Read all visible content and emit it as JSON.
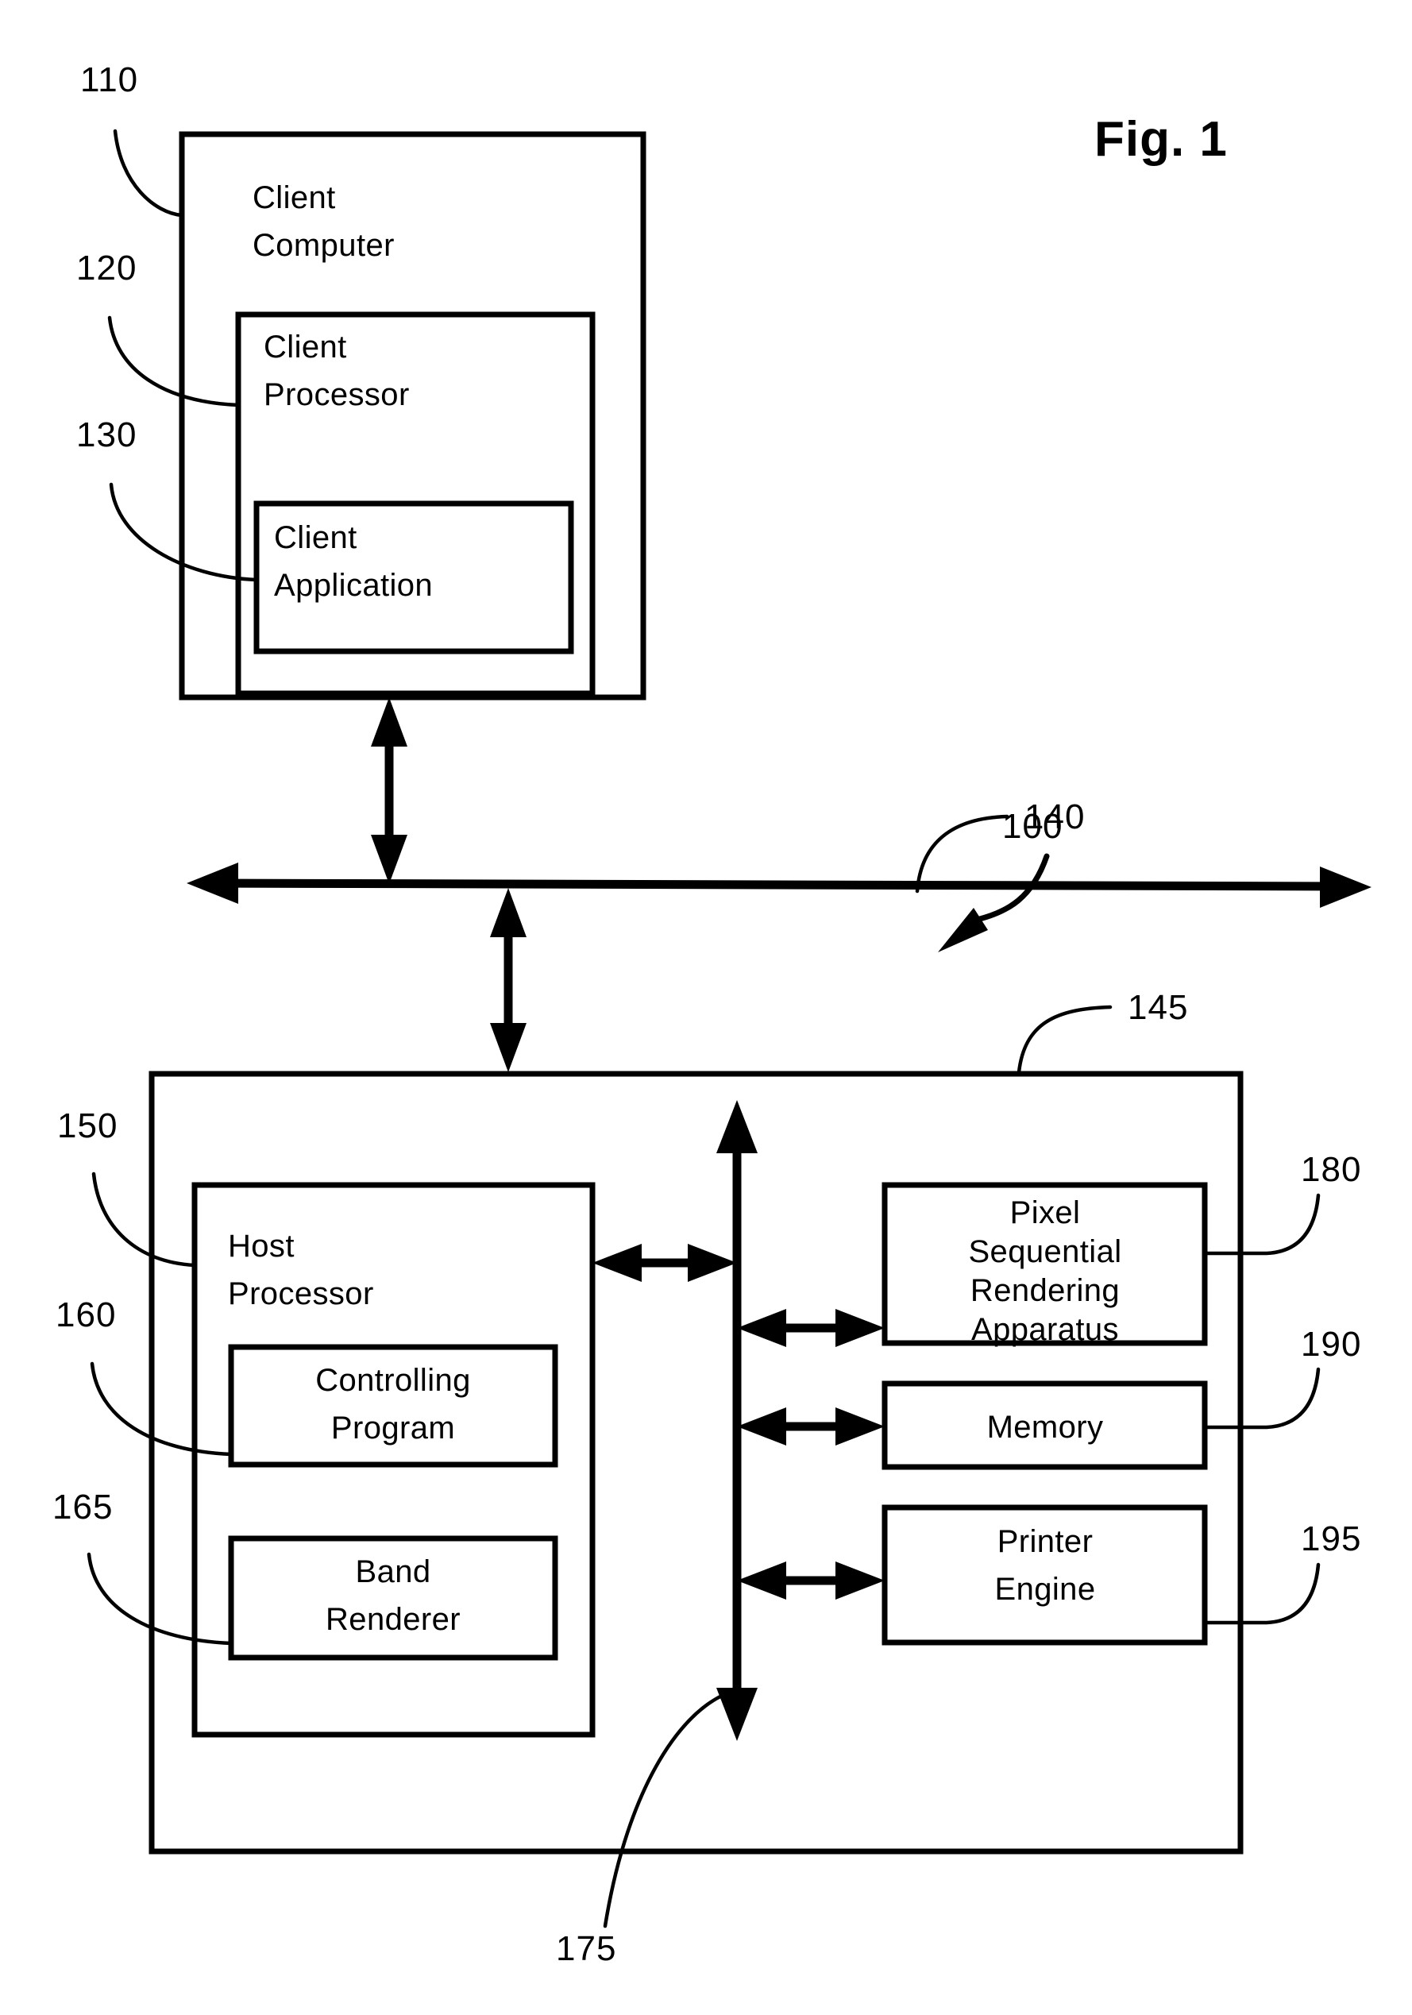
{
  "figure": {
    "title": "Fig. 1",
    "system_reference": "100"
  },
  "blocks": {
    "client_computer": {
      "label_line1": "Client",
      "label_line2": "Computer",
      "ref": "110"
    },
    "client_processor": {
      "label_line1": "Client",
      "label_line2": "Processor",
      "ref": "120"
    },
    "client_application": {
      "label_line1": "Client",
      "label_line2": "Application",
      "ref": "130"
    },
    "network": {
      "ref": "140"
    },
    "host_system": {
      "ref": "145"
    },
    "host_processor": {
      "label_line1": "Host",
      "label_line2": "Processor",
      "ref": "150"
    },
    "controlling_program": {
      "label_line1": "Controlling",
      "label_line2": "Program",
      "ref": "160"
    },
    "band_renderer": {
      "label_line1": "Band",
      "label_line2": "Renderer",
      "ref": "165"
    },
    "system_bus": {
      "ref": "175"
    },
    "pixel_sequential_rendering_apparatus": {
      "label_line1": "Pixel",
      "label_line2": "Sequential",
      "label_line3": "Rendering",
      "label_line4": "Apparatus",
      "ref": "180"
    },
    "memory": {
      "label_line1": "Memory",
      "ref": "190"
    },
    "printer_engine": {
      "label_line1": "Printer",
      "label_line2": "Engine",
      "ref": "195"
    }
  },
  "colors": {
    "ink": "#000000",
    "paper": "#ffffff"
  }
}
